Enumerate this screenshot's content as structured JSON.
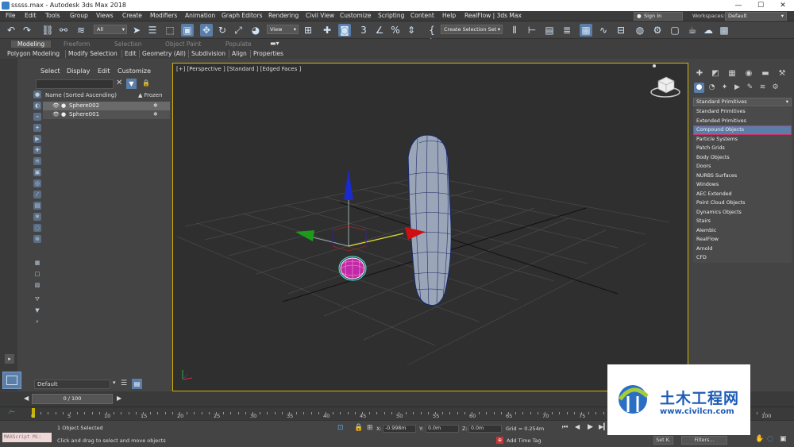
{
  "window": {
    "title": "sssss.max - Autodesk 3ds Max 2018",
    "minimize": "—",
    "maximize": "☐",
    "close": "✕"
  },
  "menu": {
    "items": [
      "File",
      "Edit",
      "Tools",
      "Group",
      "Views",
      "Create",
      "Modifiers",
      "Animation",
      "Graph Editors",
      "Rendering",
      "Civil View",
      "Customize",
      "Scripting",
      "Content",
      "Help",
      "RealFlow | 3ds Max"
    ],
    "sign_in": "Sign In",
    "workspaces_label": "Workspaces:",
    "workspace_value": "Default"
  },
  "toolbar": {
    "selection_filter": "All",
    "ref_coord": "View",
    "named_selection": "Create Selection Set"
  },
  "ribbon": {
    "tabs": [
      "Modeling",
      "Freeform",
      "Selection",
      "Object Paint",
      "Populate"
    ],
    "active_tab": "Modeling",
    "subtabs": [
      "Polygon Modeling",
      "Modify Selection",
      "Edit",
      "Geometry (All)",
      "Subdivision",
      "Align",
      "Properties"
    ]
  },
  "explorer": {
    "tabs": [
      "Select",
      "Display",
      "Edit",
      "Customize"
    ],
    "columns": {
      "name": "Name (Sorted Ascending)",
      "frozen": "▲ Frozen"
    },
    "rows": [
      {
        "name": "Sphere002",
        "frozen": "❄",
        "selected": true
      },
      {
        "name": "Sphere001",
        "frozen": "❄",
        "selected": false
      }
    ],
    "layer": "Default"
  },
  "viewport": {
    "label": "[+] [Perspective ] [Standard ] [Edged Faces ]",
    "border_color": "#d6b400"
  },
  "command_panel": {
    "category": "Standard Primitives",
    "options": [
      "Standard Primitives",
      "Extended Primitives",
      "Compound Objects",
      "Particle Systems",
      "Patch Grids",
      "Body Objects",
      "Doors",
      "NURBS Surfaces",
      "Windows",
      "AEC Extended",
      "Point Cloud Objects",
      "Dynamics Objects",
      "Stairs",
      "Alembic",
      "RealFlow",
      "Arnold",
      "CFD"
    ],
    "highlighted": "Compound Objects"
  },
  "timeline": {
    "slider": "0 / 100",
    "ticks": [
      "0",
      "5",
      "10",
      "15",
      "20",
      "25",
      "30",
      "35",
      "40",
      "45",
      "50",
      "55",
      "60",
      "65",
      "70",
      "75",
      "80",
      "85",
      "90",
      "95",
      "100"
    ]
  },
  "status": {
    "maxscript": "MAXScript Mi:",
    "selected": "1 Object Selected",
    "prompt": "Click and drag to select and move objects",
    "x_label": "X:",
    "x_value": "-0.998m",
    "y_label": "Y:",
    "y_value": "0.0m",
    "z_label": "Z:",
    "z_value": "0.0m",
    "grid": "Grid = 0.254m",
    "add_time_tag": "Add Time Tag",
    "set_key": "Set K.",
    "filters": "Filters..."
  },
  "watermark": {
    "cn": "土木工程网",
    "url": "www.civilcn.com"
  }
}
